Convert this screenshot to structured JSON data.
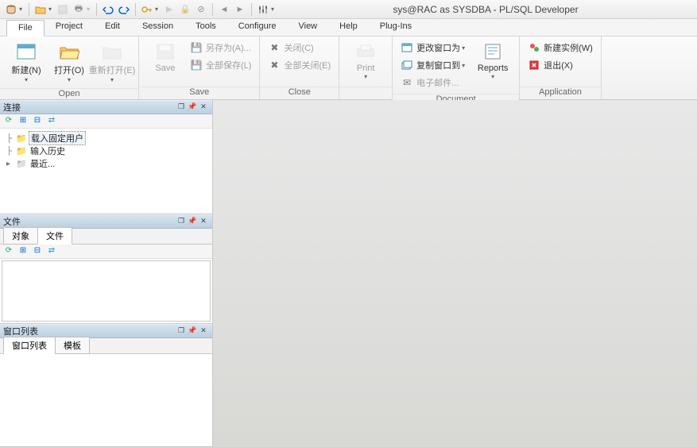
{
  "title": "sys@RAC as SYSDBA - PL/SQL Developer",
  "menu": {
    "file": "File",
    "project": "Project",
    "edit": "Edit",
    "session": "Session",
    "tools": "Tools",
    "configure": "Configure",
    "view": "View",
    "help": "Help",
    "plugins": "Plug-Ins"
  },
  "ribbon": {
    "open": {
      "label": "Open",
      "new": "新建(N)",
      "open": "打开(O)",
      "reopen": "重新打开(E)"
    },
    "save": {
      "label": "Save",
      "save": "Save",
      "saveas": "另存为(A)...",
      "saveall": "全部保存(L)"
    },
    "close": {
      "label": "Close",
      "close": "关闭(C)",
      "closeall": "全部关闭(E)"
    },
    "print": {
      "label": "",
      "print": "Print"
    },
    "document": {
      "label": "Document",
      "reports": "Reports",
      "changewin": "更改窗口为",
      "copywin": "复制窗口到",
      "email": "电子邮件..."
    },
    "application": {
      "label": "Application",
      "newinstance": "新建实例(W)",
      "exit": "退出(X)"
    }
  },
  "panels": {
    "connections": {
      "title": "连接",
      "items": [
        "载入固定用户",
        "输入历史",
        "最近..."
      ]
    },
    "files": {
      "title": "文件",
      "tabs": [
        "对象",
        "文件"
      ]
    },
    "windowlist": {
      "title": "窗口列表",
      "tabs": [
        "窗口列表",
        "模板"
      ]
    }
  }
}
